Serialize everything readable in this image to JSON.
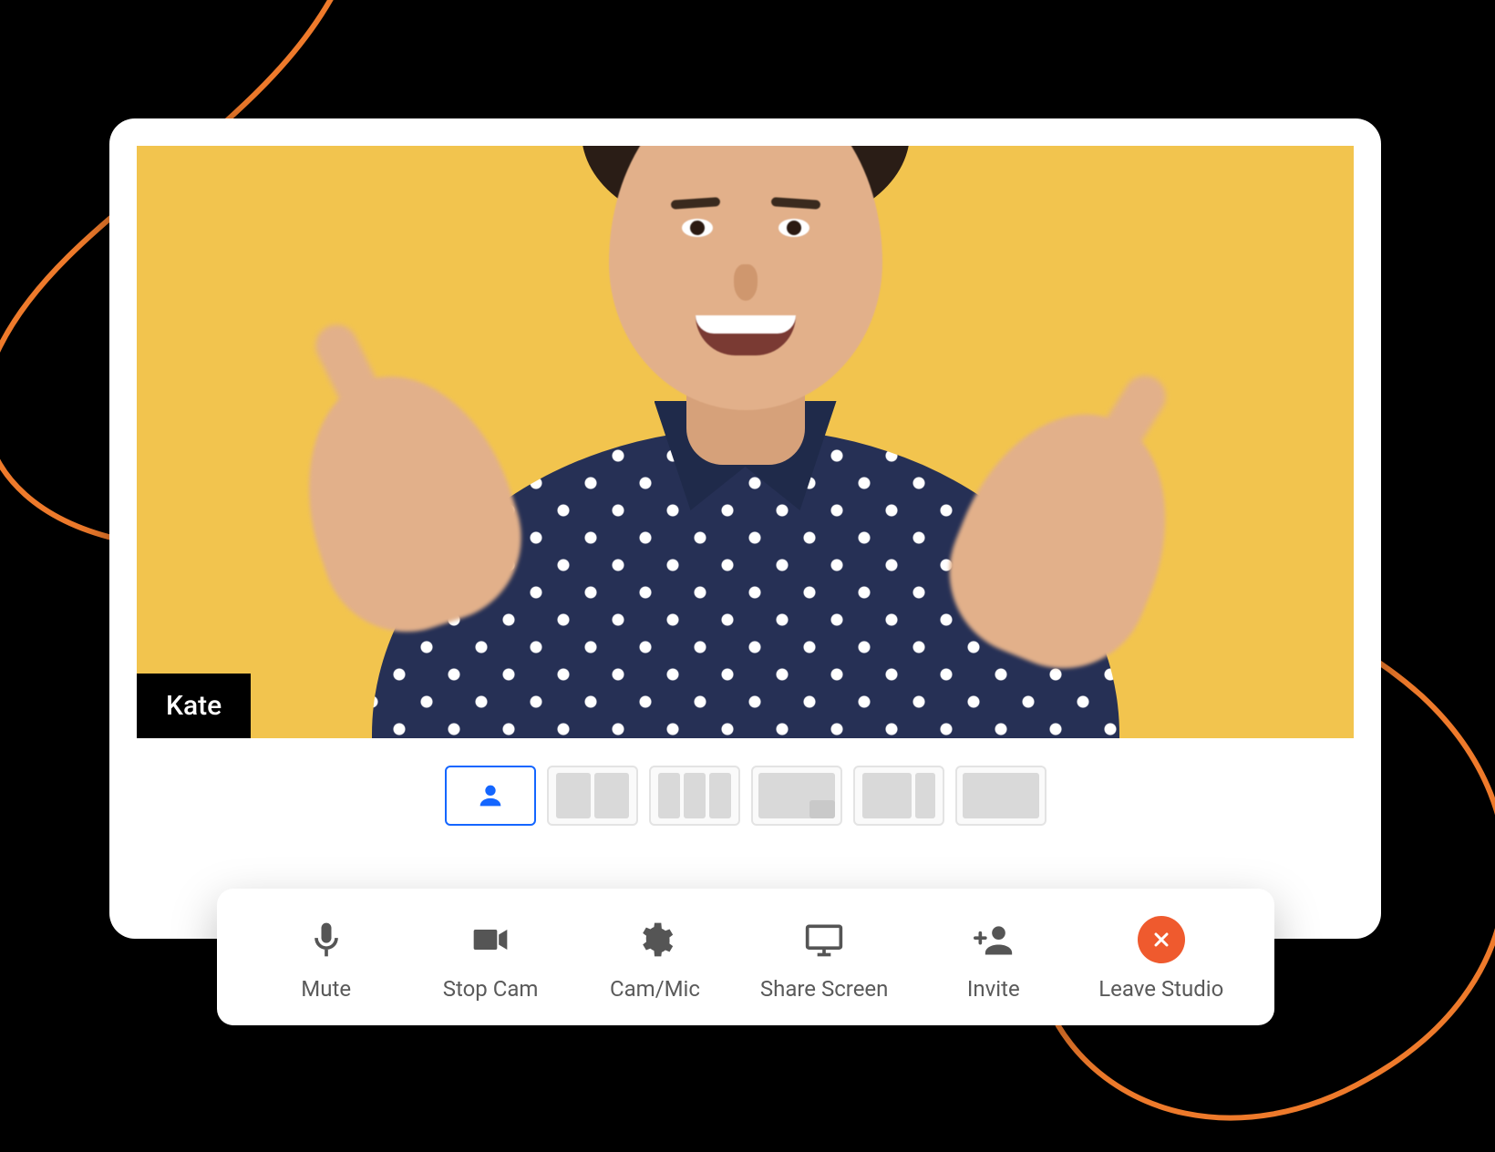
{
  "participant": {
    "name": "Kate"
  },
  "layouts": {
    "active_index": 0,
    "options": [
      {
        "id": "single",
        "active": true
      },
      {
        "id": "two-up",
        "active": false
      },
      {
        "id": "grid-3",
        "active": false
      },
      {
        "id": "pip",
        "active": false
      },
      {
        "id": "side",
        "active": false
      },
      {
        "id": "full",
        "active": false
      }
    ]
  },
  "toolbar": {
    "mute": {
      "label": "Mute",
      "icon": "mic-icon"
    },
    "stop_cam": {
      "label": "Stop Cam",
      "icon": "camera-icon"
    },
    "cam_mic": {
      "label": "Cam/Mic",
      "icon": "gear-icon"
    },
    "share": {
      "label": "Share Screen",
      "icon": "monitor-icon"
    },
    "invite": {
      "label": "Invite",
      "icon": "invite-icon"
    },
    "leave": {
      "label": "Leave Studio",
      "icon": "close-icon"
    }
  },
  "colors": {
    "video_bg": "#f2c44e",
    "accent": "#1466ff",
    "leave": "#ef5a2e",
    "swoosh": "#ee7a2b"
  }
}
